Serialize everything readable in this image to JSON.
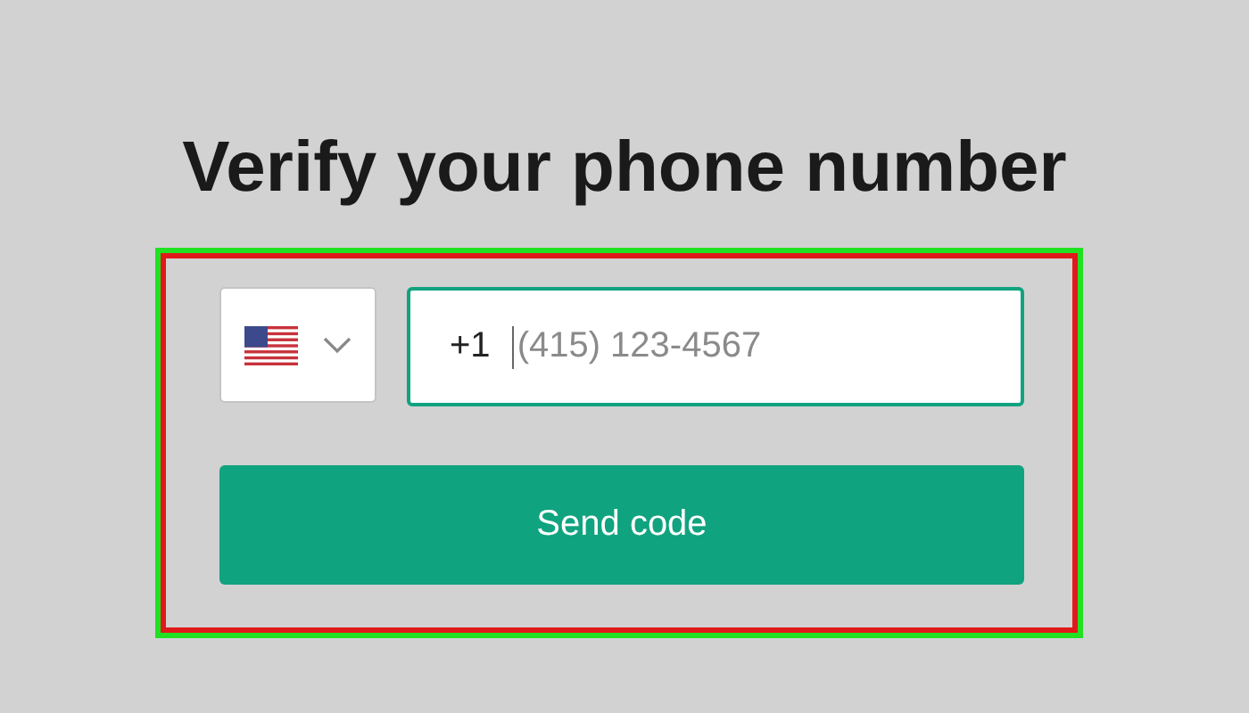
{
  "title": "Verify your phone number",
  "phone_field": {
    "prefix": "+1",
    "placeholder": "(415) 123-4567",
    "focused": true
  },
  "button": {
    "label": "Send code"
  }
}
